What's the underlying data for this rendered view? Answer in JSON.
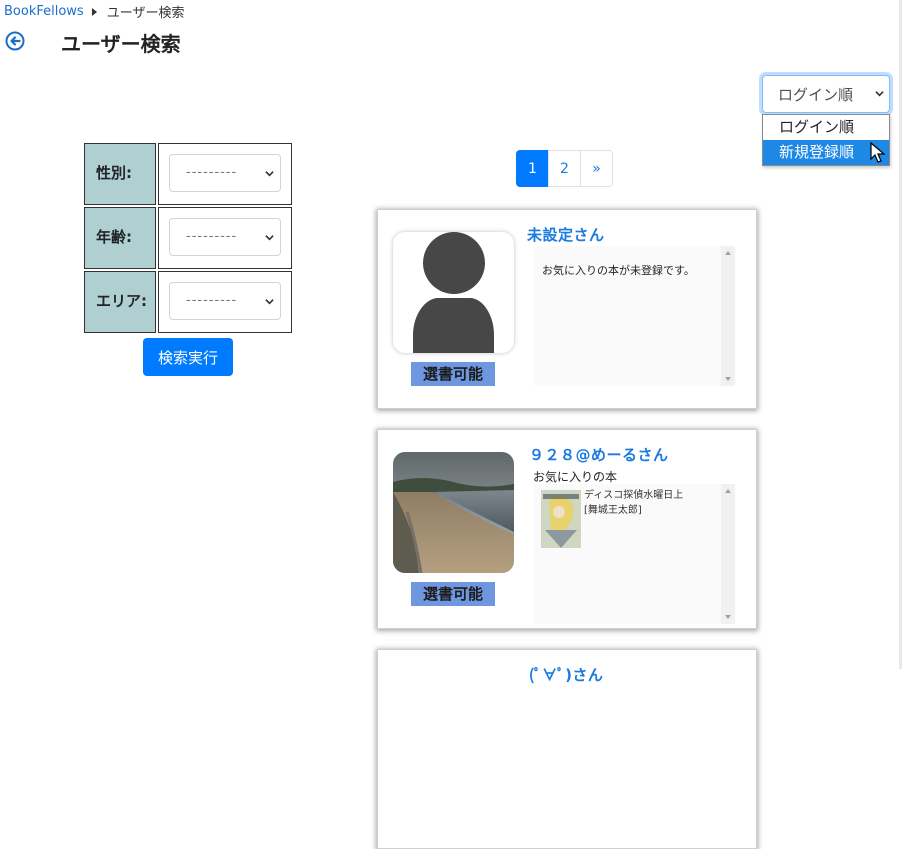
{
  "breadcrumb": {
    "home": "BookFellows",
    "current": "ユーザー検索"
  },
  "page": {
    "title": "ユーザー検索"
  },
  "sort": {
    "selected": "ログイン順",
    "options": [
      "ログイン順",
      "新規登録順"
    ],
    "highlighted": "新規登録順"
  },
  "filters": [
    {
      "label": "性別:",
      "value": "---------"
    },
    {
      "label": "年齢:",
      "value": "---------"
    },
    {
      "label": "エリア:",
      "value": "---------"
    }
  ],
  "search_button": "検索実行",
  "pagination": {
    "pages": [
      "1",
      "2"
    ],
    "next": "»",
    "current": "1"
  },
  "users": [
    {
      "name": "未設定さん",
      "avatar": "default-user-icon",
      "badge": "選書可能",
      "favorites_empty": "お気に入りの本が未登録です。"
    },
    {
      "name": "９２８@めーるさん",
      "avatar": "beach-photo",
      "badge": "選書可能",
      "favorites_heading": "お気に入りの本",
      "book": {
        "title": "ディスコ探偵水曜日上",
        "author": "[舞城王太郎]"
      }
    },
    {
      "name": "(ﾟ∀ﾟ)さん"
    }
  ],
  "colors": {
    "accent": "#007bff",
    "label_bg": "#b0cfd1",
    "badge_bg": "#6f97e0",
    "name_color": "#1a7ae0"
  }
}
